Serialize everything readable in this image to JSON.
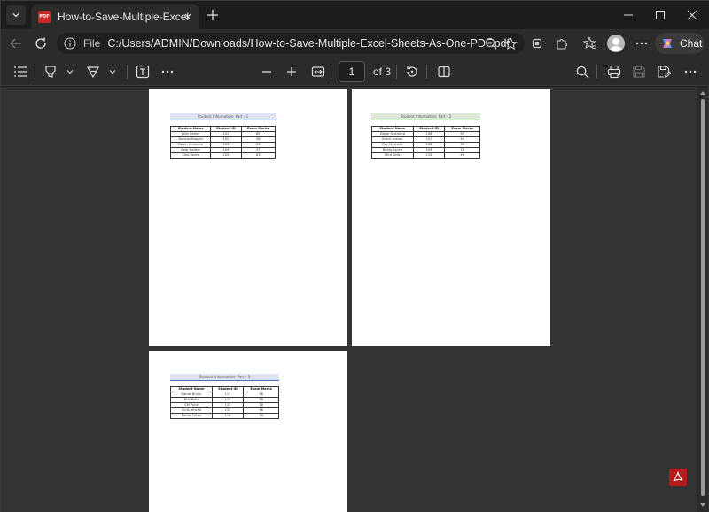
{
  "tab": {
    "title": "How-to-Save-Multiple-Excel-Sheets-As-One-PDF.pdf",
    "favicon_text": "PDF"
  },
  "address": {
    "prefix": "File",
    "url": "C:/Users/ADMIN/Downloads/How-to-Save-Multiple-Excel-Sheets-As-One-PDF.pdf"
  },
  "chat": {
    "label": "Chat"
  },
  "toolbar": {
    "current_page": "1",
    "page_of": "of 3"
  },
  "pages": [
    {
      "title": "Student Information: Part - 1",
      "title_bg": "#dde3f2",
      "headers": [
        "Student Name",
        "Student ID",
        "Exam Marks"
      ],
      "rows": [
        [
          "Jello Carrot",
          "101",
          "89"
        ],
        [
          "Duncan Brogini",
          "102",
          "56"
        ],
        [
          "Devin Andraste",
          "103",
          "23"
        ],
        [
          "Seth Nollers",
          "104",
          "57"
        ],
        [
          "Cleo Binda",
          "105",
          "63"
        ]
      ]
    },
    {
      "title": "Student Information: Part - 2",
      "title_bg": "#dde9d8",
      "headers": [
        "Student Name",
        "Student ID",
        "Exam Marks"
      ],
      "rows": [
        [
          "Edgar Gueirand",
          "106",
          "67"
        ],
        [
          "Brock Lesnar",
          "107",
          "45"
        ],
        [
          "Rey Mysterio",
          "108",
          "35"
        ],
        [
          "Becky Lynch",
          "109",
          "78"
        ],
        [
          "Miro Sells",
          "110",
          "46"
        ]
      ]
    },
    {
      "title": "Student Information: Part - 3",
      "title_bg": "#dde3f2",
      "headers": [
        "Student Name",
        "Student ID",
        "Exam Marks"
      ],
      "rows": [
        [
          "Daniel Bryan",
          "111",
          "38"
        ],
        [
          "Bris Balls",
          "112",
          "68"
        ],
        [
          "CM Punk",
          "113",
          "28"
        ],
        [
          "Chris Jericho",
          "115",
          "96"
        ],
        [
          "Randy Orton",
          "116",
          "56"
        ]
      ]
    }
  ]
}
